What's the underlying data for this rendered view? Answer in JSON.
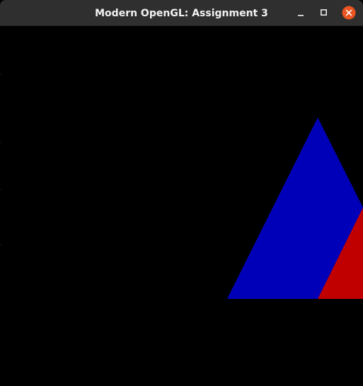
{
  "window": {
    "title": "Modern OpenGL: Assignment 3",
    "controls": [
      {
        "name": "minimize-button",
        "icon": "minimize-icon"
      },
      {
        "name": "maximize-button",
        "icon": "maximize-icon"
      },
      {
        "name": "close-button",
        "icon": "close-icon"
      }
    ]
  },
  "colors": {
    "titlebar": "#2f2f2f",
    "title_text": "#f2f2f2",
    "close_button": "#e95420",
    "viewport_background": "#000000",
    "triangle_blue": "#0000b8",
    "triangle_red": "#c00000"
  },
  "scene": {
    "shapes": [
      {
        "name": "blue-triangle",
        "color": "#0000b8"
      },
      {
        "name": "red-triangle",
        "color": "#c00000"
      }
    ]
  }
}
